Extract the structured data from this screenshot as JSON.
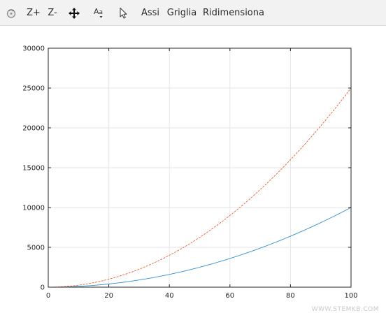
{
  "toolbar": {
    "zoom_in_label": "Z+",
    "zoom_out_label": "Z-",
    "axes_label": "Assi",
    "grid_label": "Griglia",
    "autoscale_label": "Ridimensiona",
    "icons": [
      "rotate-icon",
      "pan-icon",
      "text-icon",
      "pointer-icon"
    ]
  },
  "watermark": "WWW.STEMKB.COM",
  "colors": {
    "series1": "#2e8fd1",
    "series2": "#e8613a",
    "grid": "#e6e6e6",
    "axes": "#262626"
  },
  "chart_data": {
    "type": "line",
    "title": "",
    "xlabel": "",
    "ylabel": "",
    "xlim": [
      0,
      100
    ],
    "ylim": [
      0,
      30000
    ],
    "xticks": [
      0,
      20,
      40,
      60,
      80,
      100
    ],
    "yticks": [
      0,
      5000,
      10000,
      15000,
      20000,
      25000,
      30000
    ],
    "grid": true,
    "x": [
      0,
      10,
      20,
      30,
      40,
      50,
      60,
      70,
      80,
      90,
      100
    ],
    "series": [
      {
        "values": [
          0,
          100,
          400,
          900,
          1600,
          2500,
          3600,
          4900,
          6400,
          8100,
          10000
        ],
        "style": "solid"
      },
      {
        "values": [
          0,
          250,
          1000,
          2250,
          4000,
          6250,
          9000,
          12250,
          16000,
          20250,
          25000
        ],
        "style": "dashed"
      }
    ]
  }
}
